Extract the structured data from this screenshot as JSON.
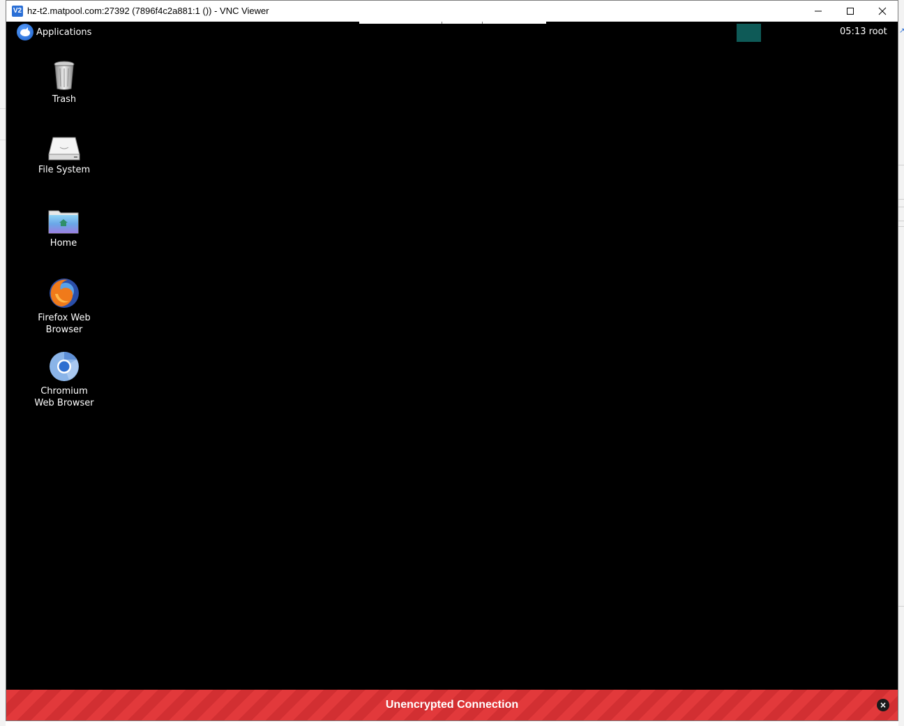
{
  "window": {
    "title": "hz-t2.matpool.com:27392 (7896f4c2a881:1 ()) - VNC Viewer",
    "app_icon_text": "V2",
    "controls": {
      "minimize": "minimize-icon",
      "maximize": "maximize-icon",
      "close": "close-icon"
    }
  },
  "desktop": {
    "menu_label": "Applications",
    "clock_text": "05:13",
    "user_text": "root",
    "workspace_color": "#0e5a57",
    "icons": [
      {
        "label_line1": "Trash",
        "label_line2": "",
        "icon": "trash-icon"
      },
      {
        "label_line1": "File System",
        "label_line2": "",
        "icon": "drive-icon"
      },
      {
        "label_line1": "Home",
        "label_line2": "",
        "icon": "home-folder-icon"
      },
      {
        "label_line1": "Firefox Web",
        "label_line2": "Browser",
        "icon": "firefox-icon"
      },
      {
        "label_line1": "Chromium",
        "label_line2": "Web Browser",
        "icon": "chromium-icon"
      }
    ]
  },
  "banner": {
    "text": "Unencrypted Connection",
    "close_glyph": "×",
    "color": "#e2393b"
  }
}
